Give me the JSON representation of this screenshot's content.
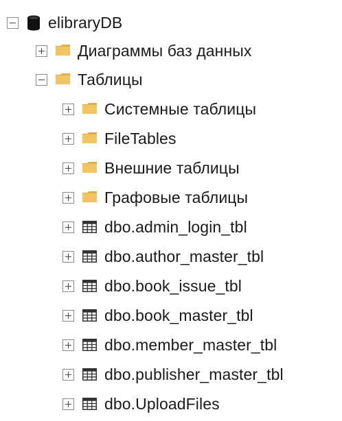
{
  "tree": {
    "root": {
      "label": "elibraryDB",
      "icon": "database-icon",
      "expanded": true
    },
    "nodes": [
      {
        "label": "Диаграммы баз данных",
        "icon": "folder-icon",
        "expanded": false
      },
      {
        "label": "Таблицы",
        "icon": "folder-icon",
        "expanded": true
      },
      {
        "label": "Системные таблицы",
        "icon": "folder-icon",
        "expanded": false
      },
      {
        "label": "FileTables",
        "icon": "folder-icon",
        "expanded": false
      },
      {
        "label": "Внешние таблицы",
        "icon": "folder-icon",
        "expanded": false
      },
      {
        "label": "Графовые таблицы",
        "icon": "folder-icon",
        "expanded": false
      },
      {
        "label": "dbo.admin_login_tbl",
        "icon": "table-icon",
        "expanded": false
      },
      {
        "label": "dbo.author_master_tbl",
        "icon": "table-icon",
        "expanded": false
      },
      {
        "label": "dbo.book_issue_tbl",
        "icon": "table-icon",
        "expanded": false
      },
      {
        "label": "dbo.book_master_tbl",
        "icon": "table-icon",
        "expanded": false
      },
      {
        "label": "dbo.member_master_tbl",
        "icon": "table-icon",
        "expanded": false
      },
      {
        "label": "dbo.publisher_master_tbl",
        "icon": "table-icon",
        "expanded": false
      },
      {
        "label": "dbo.UploadFiles",
        "icon": "table-icon",
        "expanded": false
      }
    ]
  },
  "colors": {
    "folder": "#f2c464",
    "folder_tab": "#e0ae48",
    "database": "#111111",
    "table_border": "#333333",
    "toggle_border": "#8a8a8a",
    "text": "#1a1a1a"
  }
}
